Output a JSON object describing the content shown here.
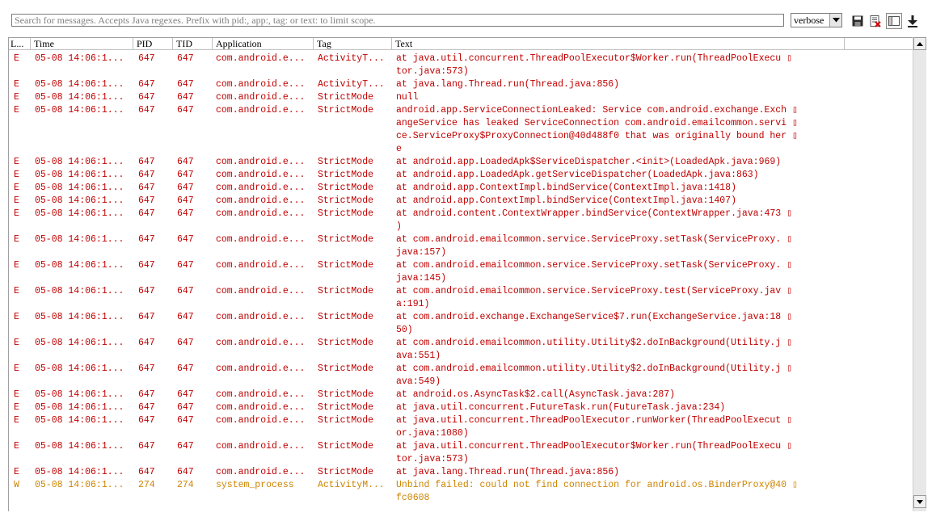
{
  "search": {
    "placeholder": "Search for messages. Accepts Java regexes. Prefix with pid:, app:, tag: or text: to limit scope."
  },
  "log_level": {
    "selected": "verbose"
  },
  "toolbar": {
    "buttons": [
      {
        "icon": "save-icon"
      },
      {
        "icon": "clear-log-icon"
      },
      {
        "icon": "toggle-view-icon"
      },
      {
        "icon": "scroll-lock-icon"
      }
    ]
  },
  "colors": {
    "error": "#c00000",
    "warning": "#cc8400",
    "header_text": "#000000"
  },
  "columns": {
    "level": "L...",
    "time": "Time",
    "pid": "PID",
    "tid": "TID",
    "application": "Application",
    "tag": "Tag",
    "text": "Text"
  },
  "rows": [
    {
      "level": "E",
      "time": "05-08 14:06:1...",
      "pid": "647",
      "tid": "647",
      "app": "com.android.e...",
      "tag": "ActivityT...",
      "text": [
        "at java.util.concurrent.ThreadPoolExecutor$Worker.run(ThreadPoolExecu ▯",
        "tor.java:573)"
      ]
    },
    {
      "level": "E",
      "time": "05-08 14:06:1...",
      "pid": "647",
      "tid": "647",
      "app": "com.android.e...",
      "tag": "ActivityT...",
      "text": [
        "at java.lang.Thread.run(Thread.java:856)"
      ]
    },
    {
      "level": "E",
      "time": "05-08 14:06:1...",
      "pid": "647",
      "tid": "647",
      "app": "com.android.e...",
      "tag": "StrictMode",
      "text": [
        "null"
      ]
    },
    {
      "level": "E",
      "time": "05-08 14:06:1...",
      "pid": "647",
      "tid": "647",
      "app": "com.android.e...",
      "tag": "StrictMode",
      "text": [
        "android.app.ServiceConnectionLeaked: Service com.android.exchange.Exch ▯",
        "angeService has leaked ServiceConnection com.android.emailcommon.servi ▯",
        "ce.ServiceProxy$ProxyConnection@40d488f0 that was originally bound her ▯",
        "e"
      ]
    },
    {
      "level": "E",
      "time": "05-08 14:06:1...",
      "pid": "647",
      "tid": "647",
      "app": "com.android.e...",
      "tag": "StrictMode",
      "text": [
        "at android.app.LoadedApk$ServiceDispatcher.<init>(LoadedApk.java:969)"
      ]
    },
    {
      "level": "E",
      "time": "05-08 14:06:1...",
      "pid": "647",
      "tid": "647",
      "app": "com.android.e...",
      "tag": "StrictMode",
      "text": [
        "at android.app.LoadedApk.getServiceDispatcher(LoadedApk.java:863)"
      ]
    },
    {
      "level": "E",
      "time": "05-08 14:06:1...",
      "pid": "647",
      "tid": "647",
      "app": "com.android.e...",
      "tag": "StrictMode",
      "text": [
        "at android.app.ContextImpl.bindService(ContextImpl.java:1418)"
      ]
    },
    {
      "level": "E",
      "time": "05-08 14:06:1...",
      "pid": "647",
      "tid": "647",
      "app": "com.android.e...",
      "tag": "StrictMode",
      "text": [
        "at android.app.ContextImpl.bindService(ContextImpl.java:1407)"
      ]
    },
    {
      "level": "E",
      "time": "05-08 14:06:1...",
      "pid": "647",
      "tid": "647",
      "app": "com.android.e...",
      "tag": "StrictMode",
      "text": [
        "at android.content.ContextWrapper.bindService(ContextWrapper.java:473 ▯",
        ")"
      ]
    },
    {
      "level": "E",
      "time": "05-08 14:06:1...",
      "pid": "647",
      "tid": "647",
      "app": "com.android.e...",
      "tag": "StrictMode",
      "text": [
        "at com.android.emailcommon.service.ServiceProxy.setTask(ServiceProxy. ▯",
        "java:157)"
      ]
    },
    {
      "level": "E",
      "time": "05-08 14:06:1...",
      "pid": "647",
      "tid": "647",
      "app": "com.android.e...",
      "tag": "StrictMode",
      "text": [
        "at com.android.emailcommon.service.ServiceProxy.setTask(ServiceProxy. ▯",
        "java:145)"
      ]
    },
    {
      "level": "E",
      "time": "05-08 14:06:1...",
      "pid": "647",
      "tid": "647",
      "app": "com.android.e...",
      "tag": "StrictMode",
      "text": [
        "at com.android.emailcommon.service.ServiceProxy.test(ServiceProxy.jav ▯",
        "a:191)"
      ]
    },
    {
      "level": "E",
      "time": "05-08 14:06:1...",
      "pid": "647",
      "tid": "647",
      "app": "com.android.e...",
      "tag": "StrictMode",
      "text": [
        "at com.android.exchange.ExchangeService$7.run(ExchangeService.java:18 ▯",
        "50)"
      ]
    },
    {
      "level": "E",
      "time": "05-08 14:06:1...",
      "pid": "647",
      "tid": "647",
      "app": "com.android.e...",
      "tag": "StrictMode",
      "text": [
        "at com.android.emailcommon.utility.Utility$2.doInBackground(Utility.j ▯",
        "ava:551)"
      ]
    },
    {
      "level": "E",
      "time": "05-08 14:06:1...",
      "pid": "647",
      "tid": "647",
      "app": "com.android.e...",
      "tag": "StrictMode",
      "text": [
        "at com.android.emailcommon.utility.Utility$2.doInBackground(Utility.j ▯",
        "ava:549)"
      ]
    },
    {
      "level": "E",
      "time": "05-08 14:06:1...",
      "pid": "647",
      "tid": "647",
      "app": "com.android.e...",
      "tag": "StrictMode",
      "text": [
        "at android.os.AsyncTask$2.call(AsyncTask.java:287)"
      ]
    },
    {
      "level": "E",
      "time": "05-08 14:06:1...",
      "pid": "647",
      "tid": "647",
      "app": "com.android.e...",
      "tag": "StrictMode",
      "text": [
        "at java.util.concurrent.FutureTask.run(FutureTask.java:234)"
      ]
    },
    {
      "level": "E",
      "time": "05-08 14:06:1...",
      "pid": "647",
      "tid": "647",
      "app": "com.android.e...",
      "tag": "StrictMode",
      "text": [
        "at java.util.concurrent.ThreadPoolExecutor.runWorker(ThreadPoolExecut ▯",
        "or.java:1080)"
      ]
    },
    {
      "level": "E",
      "time": "05-08 14:06:1...",
      "pid": "647",
      "tid": "647",
      "app": "com.android.e...",
      "tag": "StrictMode",
      "text": [
        "at java.util.concurrent.ThreadPoolExecutor$Worker.run(ThreadPoolExecu ▯",
        "tor.java:573)"
      ]
    },
    {
      "level": "E",
      "time": "05-08 14:06:1...",
      "pid": "647",
      "tid": "647",
      "app": "com.android.e...",
      "tag": "StrictMode",
      "text": [
        "at java.lang.Thread.run(Thread.java:856)"
      ]
    },
    {
      "level": "W",
      "time": "05-08 14:06:1...",
      "pid": "274",
      "tid": "274",
      "app": "system_process",
      "tag": "ActivityM...",
      "text": [
        "Unbind failed: could not find connection for android.os.BinderProxy@40 ▯",
        "fc0608"
      ]
    }
  ]
}
